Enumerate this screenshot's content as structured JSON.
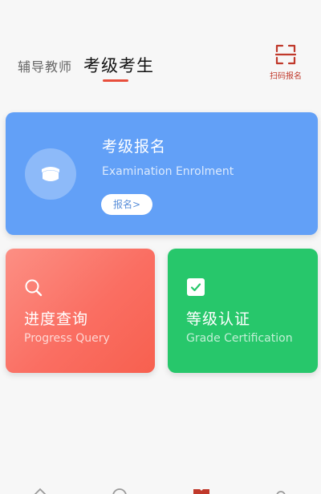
{
  "header": {
    "tabs": [
      {
        "label": "辅导教师",
        "active": false
      },
      {
        "label": "考级考生",
        "active": true
      }
    ],
    "scan_label": "扫码报名",
    "accent_color": "#e84e3c"
  },
  "cards": {
    "enrolment": {
      "title": "考级报名",
      "subtitle": "Examination Enrolment",
      "button_label": "报名>",
      "icon": "graduation-cap-icon",
      "color": "#62a0f7"
    },
    "progress": {
      "title": "进度查询",
      "subtitle": "Progress Query",
      "icon": "search-icon",
      "color": "#fa6e62"
    },
    "grade": {
      "title": "等级认证",
      "subtitle": "Grade Certification",
      "icon": "checkbox-icon",
      "color": "#27c76b"
    }
  },
  "bottom_nav": {
    "items": [
      {
        "icon": "home-icon"
      },
      {
        "icon": "compass-icon"
      },
      {
        "icon": "exam-icon",
        "active": true
      },
      {
        "icon": "profile-icon"
      }
    ]
  }
}
